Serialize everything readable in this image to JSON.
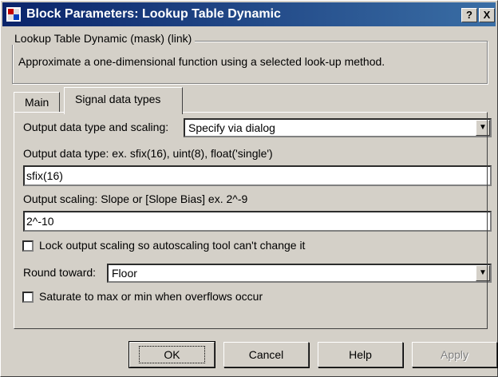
{
  "window": {
    "title": "Block Parameters: Lookup Table Dynamic",
    "help_button": "?",
    "close_button": "X"
  },
  "mask": {
    "legend": "Lookup Table Dynamic (mask) (link)",
    "description": "Approximate a one-dimensional function using a selected look-up method."
  },
  "tabs": [
    {
      "label": "Main"
    },
    {
      "label": "Signal data types"
    }
  ],
  "params": {
    "output_dtype_scaling_label": "Output data type and scaling:",
    "output_dtype_scaling_value": "Specify via dialog",
    "output_dtype_label": "Output data type:    ex.  sfix(16),  uint(8),  float('single')",
    "output_dtype_value": "sfix(16)",
    "output_scaling_label": "Output scaling:   Slope or [Slope Bias]    ex.  2^-9",
    "output_scaling_value": "2^-10",
    "lock_scaling_label": "Lock output scaling so autoscaling tool can't change it",
    "lock_scaling_checked": false,
    "round_toward_label": "Round toward:",
    "round_toward_value": "Floor",
    "saturate_label": "Saturate to max or min when overflows occur",
    "saturate_checked": false
  },
  "buttons": {
    "ok": "OK",
    "cancel": "Cancel",
    "help": "Help",
    "apply": "Apply"
  },
  "colors": {
    "title_gradient_start": "#0a246a",
    "title_gradient_end": "#3a6ea5",
    "face": "#d4d0c8"
  }
}
